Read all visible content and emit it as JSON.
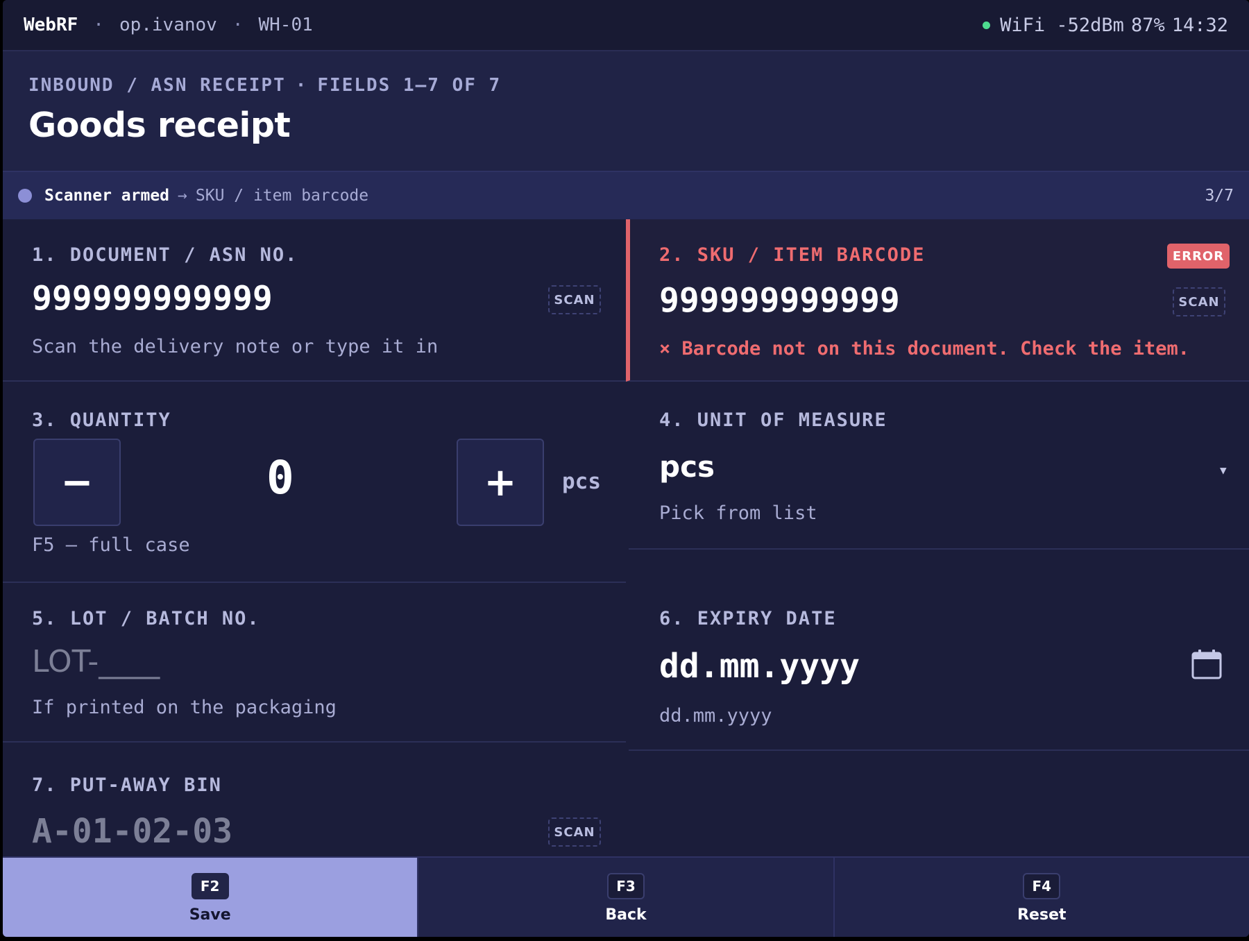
{
  "status_bar": {
    "app_name": "WebRF",
    "user": "op.ivanov",
    "warehouse": "WH-01",
    "wifi": "WiFi -52dBm",
    "battery": "87%",
    "time": "14:32",
    "wifi_color": "#4ddb8f"
  },
  "header": {
    "crumb_section": "INBOUND / ASN RECEIPT",
    "crumb_fields": "FIELDS 1–7 OF 7",
    "title": "Goods receipt"
  },
  "scanner": {
    "state": "Scanner armed",
    "arrow": "→",
    "target": "SKU / item barcode",
    "progress": "3/7"
  },
  "fields": {
    "document": {
      "label": "1. DOCUMENT / ASN NO.",
      "value": "999999999999",
      "hint": "Scan the delivery note or type it in",
      "scan_label": "SCAN"
    },
    "sku": {
      "label": "2. SKU / ITEM BARCODE",
      "value": "999999999999",
      "badge": "ERROR",
      "error_message": "× Barcode not on this document. Check the item.",
      "scan_label": "SCAN",
      "error_color": "#e0636a"
    },
    "quantity": {
      "label": "3. QUANTITY",
      "value": "0",
      "minus": "−",
      "plus": "+",
      "unit": "pcs",
      "hint": "F5 — full case"
    },
    "uom": {
      "label": "4. UNIT OF MEASURE",
      "value": "pcs",
      "hint": "Pick from list"
    },
    "lot": {
      "label": "5. LOT / BATCH NO.",
      "placeholder": "LOT-____",
      "hint": "If printed on the packaging"
    },
    "expiry": {
      "label": "6. EXPIRY DATE",
      "value": "dd.mm.yyyy",
      "hint": "dd.mm.yyyy"
    },
    "bin": {
      "label": "7. PUT-AWAY BIN",
      "placeholder": "A-01-02-03",
      "scan_label": "SCAN"
    }
  },
  "footer": {
    "save": {
      "key": "F2",
      "label": "Save"
    },
    "back": {
      "key": "F3",
      "label": "Back"
    },
    "reset": {
      "key": "F4",
      "label": "Reset"
    }
  }
}
